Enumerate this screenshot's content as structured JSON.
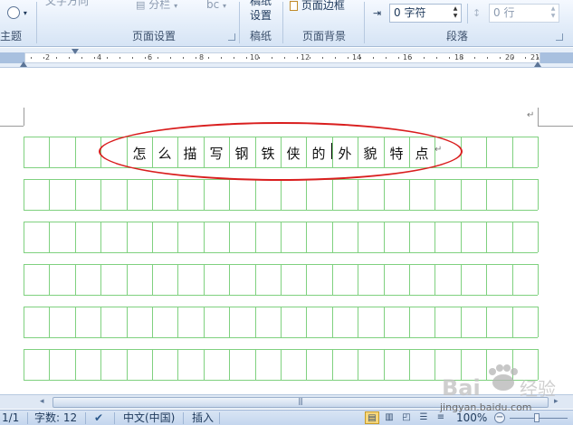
{
  "ribbon": {
    "theme_group_label": "主题",
    "page_setup": {
      "label": "页面设置",
      "text_direction_label": "文字方向",
      "columns_label": "分栏",
      "hyphenation_label": "bc"
    },
    "draft_paper": {
      "label": "稿纸",
      "button_label_top": "稿纸",
      "button_label_bottom": "设置"
    },
    "page_background": {
      "label": "页面背景",
      "page_border_label": "页面边框"
    },
    "paragraph": {
      "label": "段落",
      "indent_value": "0 字符",
      "spacing_value": "0 行"
    }
  },
  "ruler": {
    "labels": [
      "2",
      "4",
      "6",
      "8",
      "10",
      "12",
      "14",
      "16",
      "18",
      "20",
      "21"
    ]
  },
  "document": {
    "characters": [
      "怎",
      "么",
      "描",
      "写",
      "钢",
      "铁",
      "侠",
      "的",
      "外",
      "貌",
      "特",
      "点"
    ],
    "paragraph_mark": "↵"
  },
  "statusbar": {
    "page": "1/1",
    "word_count": "字数: 12",
    "language": "中文(中国)",
    "insert_mode": "插入",
    "zoom": "100%",
    "zoom_minus": "−",
    "zoom_plus": "+"
  },
  "watermark": {
    "text": "jingyan.baidu.com"
  },
  "colors": {
    "grid_line": "#7fd17f",
    "ellipse": "#d91e1e",
    "ribbon_bg": "#dfe9f5"
  }
}
